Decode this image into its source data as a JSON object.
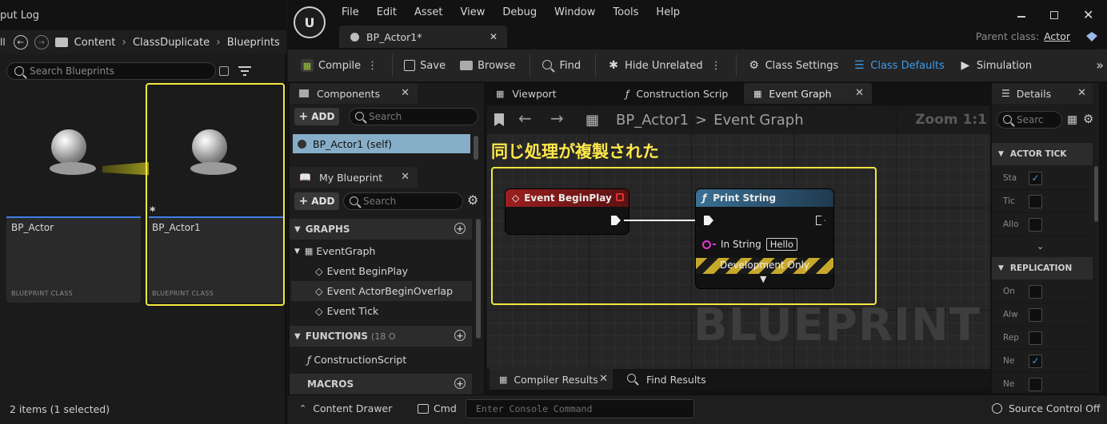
{
  "left_panel": {
    "output_tab": "put Log",
    "breadcrumb": [
      "Content",
      "ClassDuplicate",
      "Blueprints"
    ],
    "breadcrumb_left": "ll",
    "search_placeholder": "Search Blueprints",
    "assets": [
      {
        "name": "BP_Actor",
        "class": "BLUEPRINT CLASS"
      },
      {
        "name": "BP_Actor1",
        "class": "BLUEPRINT CLASS",
        "modified_marker": "*"
      }
    ],
    "items_count": "2 items (1 selected)"
  },
  "menu": [
    "File",
    "Edit",
    "Asset",
    "View",
    "Debug",
    "Window",
    "Tools",
    "Help"
  ],
  "doc_tab": {
    "label": "BP_Actor1*"
  },
  "parent_class": {
    "label": "Parent class:",
    "value": "Actor"
  },
  "toolbar": {
    "compile": "Compile",
    "save": "Save",
    "browse": "Browse",
    "find": "Find",
    "hide_unrelated": "Hide Unrelated",
    "class_settings": "Class Settings",
    "class_defaults": "Class Defaults",
    "simulation": "Simulation"
  },
  "components": {
    "tab": "Components",
    "add": "ADD",
    "search_placeholder": "Search",
    "self_item": "BP_Actor1 (self)"
  },
  "my_blueprint": {
    "tab": "My Blueprint",
    "add": "ADD",
    "search_placeholder": "Search",
    "graphs_header": "GRAPHS",
    "graph_root": "EventGraph",
    "events": [
      "Event BeginPlay",
      "Event ActorBeginOverlap",
      "Event Tick"
    ],
    "functions_header": "FUNCTIONS",
    "functions_count": "(18 O",
    "function_item": "ConstructionScript",
    "macros_header": "MACROS"
  },
  "graph_tabs": {
    "viewport": "Viewport",
    "construction": "Construction Scrip",
    "event_graph": "Event Graph"
  },
  "graph": {
    "breadcrumb_root": "BP_Actor1",
    "breadcrumb_sep": ">",
    "breadcrumb_leaf": "Event Graph",
    "zoom": "Zoom 1:1",
    "watermark": "BLUEPRINT",
    "annotation": "同じ処理が複製された",
    "node_event": "Event BeginPlay",
    "node_print": "Print String",
    "in_string_label": "In String",
    "in_string_value": "Hello",
    "dev_only": "Development Only"
  },
  "bottom_tabs": {
    "compiler": "Compiler Results",
    "find": "Find Results"
  },
  "status": {
    "content_drawer": "Content Drawer",
    "cmd": "Cmd",
    "console_placeholder": "Enter Console Command",
    "source_control": "Source Control Off"
  },
  "details": {
    "tab": "Details",
    "search_placeholder": "Searc",
    "actor_tick": "ACTOR TICK",
    "actor_tick_rows": [
      {
        "label": "Sta",
        "checked": true
      },
      {
        "label": "Tic",
        "checked": false
      },
      {
        "label": "Allo",
        "checked": false
      }
    ],
    "replication": "REPLICATION",
    "replication_rows": [
      {
        "label": "On",
        "checked": false
      },
      {
        "label": "Alw",
        "checked": false
      },
      {
        "label": "Rep",
        "checked": false
      },
      {
        "label": "Ne",
        "checked": true
      },
      {
        "label": "Ne",
        "checked": false
      }
    ]
  },
  "colors": {
    "highlight": "#f5e642",
    "accent_blue": "#3f9be8",
    "event_header": "#8e1d1d",
    "function_header": "#2f5a7a"
  }
}
